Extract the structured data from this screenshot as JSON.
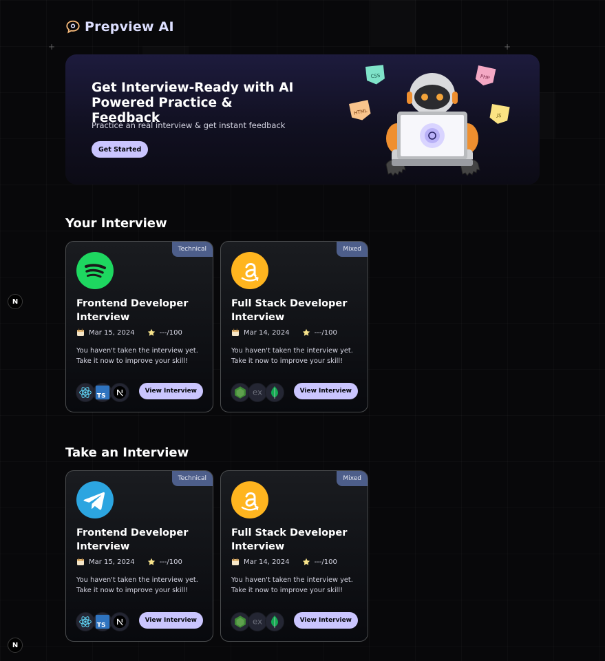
{
  "app": {
    "name": "Prepview AI"
  },
  "hero": {
    "title": "Get Interview-Ready with AI Powered Practice & Feedback",
    "subtitle": "Practice an real interview & get instant feedback",
    "cta_label": "Get Started",
    "stickers": [
      "CSS",
      "PHP",
      "HTML",
      "JS"
    ]
  },
  "sections": {
    "your_interview": "Your Interview",
    "take_interview": "Take an Interview"
  },
  "your_interviews": [
    {
      "badge": "Technical",
      "title": "Frontend Developer Interview",
      "date": "Mar 15, 2024",
      "score": "---/100",
      "description": "You haven't taken the interview yet. Take it now to improve your skill!",
      "button": "View Interview",
      "logo_icon": "spotify-icon",
      "tech_icons": [
        "react-icon",
        "typescript-icon",
        "nextjs-icon"
      ],
      "tech_ts_label": "TS"
    },
    {
      "badge": "Mixed",
      "title": "Full Stack Developer Interview",
      "date": "Mar 14, 2024",
      "score": "---/100",
      "description": "You haven't taken the interview yet. Take it now to improve your skill!",
      "button": "View Interview",
      "logo_icon": "amazon-icon",
      "tech_icons": [
        "nodejs-icon",
        "express-icon",
        "mongodb-icon"
      ],
      "tech_ex_label": "ex"
    }
  ],
  "take_interviews": [
    {
      "badge": "Technical",
      "title": "Frontend Developer Interview",
      "date": "Mar 15, 2024",
      "score": "---/100",
      "description": "You haven't taken the interview yet. Take it now to improve your skill!",
      "button": "View Interview",
      "logo_icon": "telegram-icon",
      "tech_icons": [
        "react-icon",
        "typescript-icon",
        "nextjs-icon"
      ],
      "tech_ts_label": "TS"
    },
    {
      "badge": "Mixed",
      "title": "Full Stack Developer Interview",
      "date": "Mar 14, 2024",
      "score": "---/100",
      "description": "You haven't taken the interview yet. Take it now to improve your skill!",
      "button": "View Interview",
      "logo_icon": "amazon-icon",
      "tech_icons": [
        "nodejs-icon",
        "express-icon",
        "mongodb-icon"
      ],
      "tech_ex_label": "ex"
    }
  ],
  "dev_indicator": "N",
  "colors": {
    "background": "#08080a",
    "accent": "#cac5fe",
    "badge": "#4d5e8a",
    "spotify": "#1ed760",
    "amazon": "#ffb51f",
    "telegram": "#2ca5e0"
  }
}
